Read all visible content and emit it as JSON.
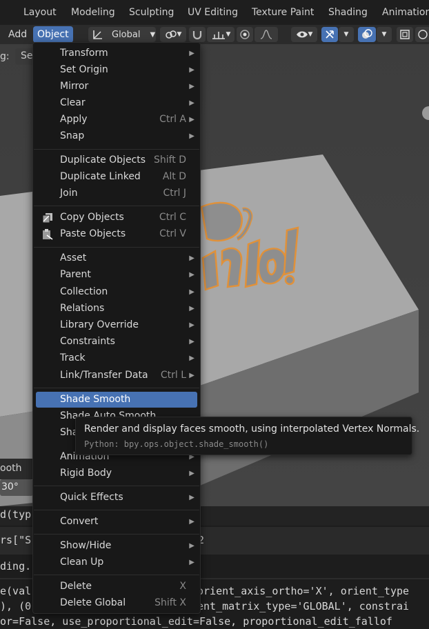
{
  "workspace_tabs": [
    "Layout",
    "Modeling",
    "Sculpting",
    "UV Editing",
    "Texture Paint",
    "Shading",
    "Animation"
  ],
  "header": {
    "add_label": "Add",
    "object_label": "Object",
    "orientation_label": "Global"
  },
  "left_panel": {
    "label_g": "g:",
    "label_se": "Se",
    "label_ooth": "ooth",
    "angle_value": "30°"
  },
  "console_lines": [
    "d(typ",
    "rs[\"S",
    "ding.",
    "e(val",
    "), (0",
    "or=False, use_proportional_edit=False, proportional_edit_fallof"
  ],
  "console_right": {
    "line2_tail": "2",
    "line4_tail": "orient_axis_ortho='X', orient_type",
    "line5_tail": "ent_matrix_type='GLOBAL', constrai"
  },
  "menu": {
    "items": [
      {
        "label": "Transform",
        "shortcut": "",
        "submenu": true
      },
      {
        "label": "Set Origin",
        "shortcut": "",
        "submenu": true
      },
      {
        "label": "Mirror",
        "shortcut": "",
        "submenu": true
      },
      {
        "label": "Clear",
        "shortcut": "",
        "submenu": true
      },
      {
        "label": "Apply",
        "shortcut": "Ctrl A",
        "submenu": true
      },
      {
        "label": "Snap",
        "shortcut": "",
        "submenu": true
      },
      {
        "label": "Duplicate Objects",
        "shortcut": "Shift D",
        "submenu": false
      },
      {
        "label": "Duplicate Linked",
        "shortcut": "Alt D",
        "submenu": false
      },
      {
        "label": "Join",
        "shortcut": "Ctrl J",
        "submenu": false
      },
      {
        "label": "Copy Objects",
        "shortcut": "Ctrl C",
        "submenu": false
      },
      {
        "label": "Paste Objects",
        "shortcut": "Ctrl V",
        "submenu": false
      },
      {
        "label": "Asset",
        "shortcut": "",
        "submenu": true
      },
      {
        "label": "Parent",
        "shortcut": "",
        "submenu": true
      },
      {
        "label": "Collection",
        "shortcut": "",
        "submenu": true
      },
      {
        "label": "Relations",
        "shortcut": "",
        "submenu": true
      },
      {
        "label": "Library Override",
        "shortcut": "",
        "submenu": true
      },
      {
        "label": "Constraints",
        "shortcut": "",
        "submenu": true
      },
      {
        "label": "Track",
        "shortcut": "",
        "submenu": true
      },
      {
        "label": "Link/Transfer Data",
        "shortcut": "Ctrl L",
        "submenu": true
      },
      {
        "label": "Shade Smooth",
        "shortcut": "",
        "submenu": false
      },
      {
        "label": "Shade Auto Smooth",
        "shortcut": "",
        "submenu": false
      },
      {
        "label": "Sha",
        "shortcut": "",
        "submenu": false
      },
      {
        "label": "Animation",
        "shortcut": "",
        "submenu": true
      },
      {
        "label": "Rigid Body",
        "shortcut": "",
        "submenu": true
      },
      {
        "label": "Quick Effects",
        "shortcut": "",
        "submenu": true
      },
      {
        "label": "Convert",
        "shortcut": "",
        "submenu": true
      },
      {
        "label": "Show/Hide",
        "shortcut": "",
        "submenu": true
      },
      {
        "label": "Clean Up",
        "shortcut": "",
        "submenu": true
      },
      {
        "label": "Delete",
        "shortcut": "X",
        "submenu": false
      },
      {
        "label": "Delete Global",
        "shortcut": "Shift X",
        "submenu": false
      }
    ]
  },
  "tooltip": {
    "description": "Render and display faces smooth, using interpolated Vertex Normals.",
    "python": "Python: bpy.ops.object.shade_smooth()"
  },
  "colors": {
    "accent": "#4772b3",
    "selection_outline": "#e0913a",
    "menu_bg": "#181818"
  }
}
